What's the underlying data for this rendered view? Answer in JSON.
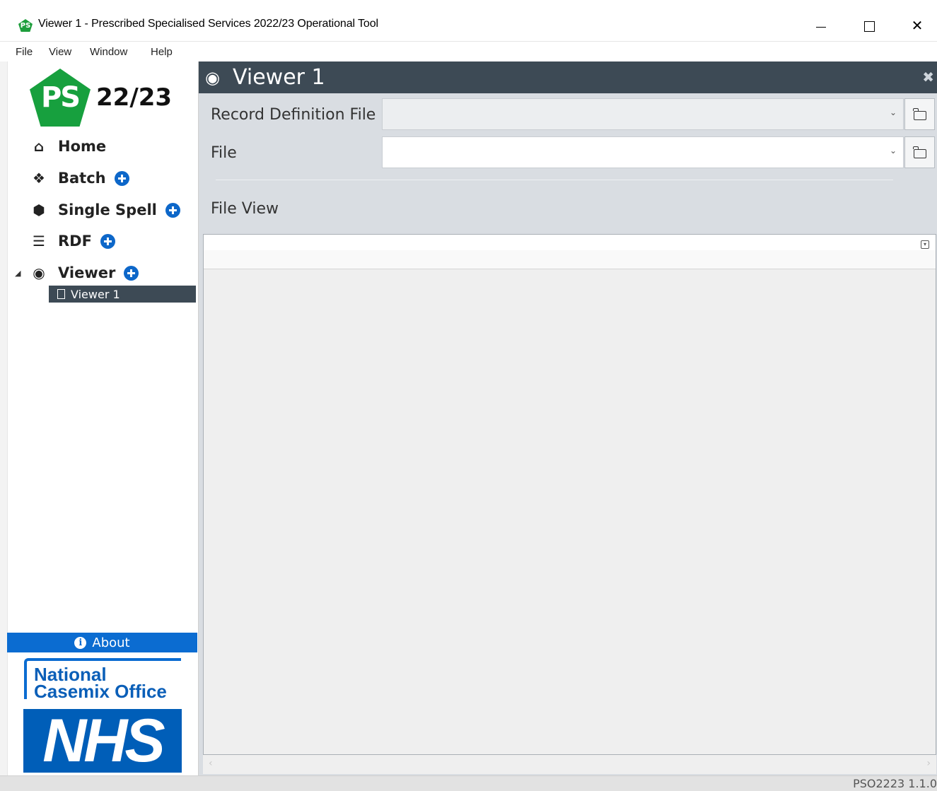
{
  "window": {
    "icon_text": "PS",
    "title": "Viewer 1 - Prescribed Specialised Services 2022/23 Operational Tool",
    "minimize": "",
    "close": "✕"
  },
  "menu": [
    "File",
    "View",
    "Window",
    "Help"
  ],
  "sidebar": {
    "logo_mark": "PS",
    "logo_year": "22/23",
    "nav": [
      {
        "label": "Home",
        "icon": "home-icon"
      },
      {
        "label": "Batch",
        "icon": "cubes-icon"
      },
      {
        "label": "Single Spell",
        "icon": "cube-icon"
      },
      {
        "label": "RDF",
        "icon": "document-icon"
      },
      {
        "label": "Viewer",
        "icon": "eye-icon"
      }
    ],
    "tree_child": "Viewer 1",
    "about": "About",
    "nco_line1": "National",
    "nco_line2": "Casemix Office",
    "nhs": "NHS"
  },
  "panel": {
    "title": "Viewer 1",
    "record_definition_label": "Record Definition File",
    "record_definition_value": "",
    "file_label": "File",
    "file_value": "",
    "file_view_label": "File View"
  },
  "status": {
    "version": "PSO2223 1.1.0"
  },
  "colors": {
    "accent": "#0b6cd1",
    "header": "#3d4a55",
    "logo_green": "#17a03e",
    "nhs_blue": "#005eb8"
  }
}
